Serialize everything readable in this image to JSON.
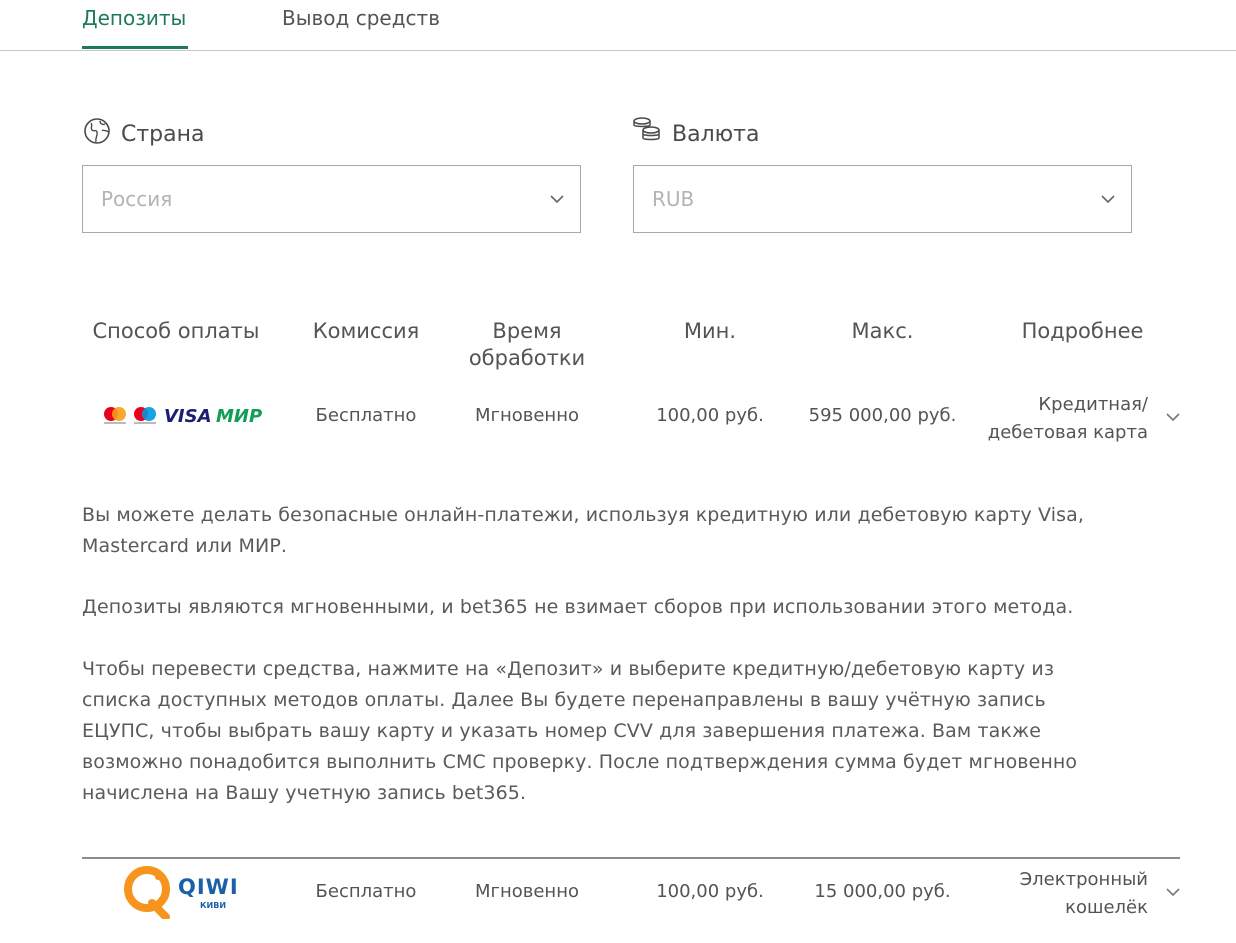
{
  "tabs": [
    {
      "label": "Депозиты",
      "active": true
    },
    {
      "label": "Вывод средств",
      "active": false
    }
  ],
  "filters": {
    "country": {
      "label": "Страна",
      "icon": "globe-icon",
      "value": "Россия"
    },
    "currency": {
      "label": "Валюта",
      "icon": "coins-icon",
      "value": "RUB"
    }
  },
  "table": {
    "headers": [
      "Способ оплаты",
      "Комиссия",
      "Время обработки",
      "Мин.",
      "Макс.",
      "Подробнее"
    ],
    "header_time_line1": "Время",
    "header_time_line2": "обработки",
    "rows": [
      {
        "method_icons": [
          "mastercard-icon",
          "maestro-icon",
          "visa-logo",
          "mir-logo"
        ],
        "visa_text": "VISA",
        "mir_text": "МИР",
        "commission": "Бесплатно",
        "time": "Мгновенно",
        "min": "100,00 руб.",
        "max": "595 000,00 руб.",
        "details_line1": "Кредитная/",
        "details_line2": "дебетовая карта",
        "expanded": true
      },
      {
        "method_icons": [
          "qiwi-logo"
        ],
        "qiwi_text": "QIWI",
        "qiwi_sub": "КИВИ",
        "commission": "Бесплатно",
        "time": "Мгновенно",
        "min": "100,00 руб.",
        "max": "15 000,00 руб.",
        "details_line1": "Электронный",
        "details_line2": "кошелёк",
        "expanded": false
      }
    ]
  },
  "description": {
    "p1_line1": "Вы можете делать безопасные онлайн-платежи, используя кредитную или дебетовую карту Visa,",
    "p1_line2": "Mastercard или МИР.",
    "p2": "Депозиты являются мгновенными, и bet365 не взимает сборов при использовании этого метода.",
    "p3_lines": [
      "Чтобы перевести средства, нажмите на «Депозит» и выберите кредитную/дебетовую карту из",
      "списка доступных методов оплаты. Далее Вы будете перенаправлены в вашу учётную запись",
      "ЕЦУПС, чтобы выбрать вашу карту и указать номер CVV для завершения платежа. Вам также",
      "возможно понадобится выполнить СМС проверку. После подтверждения сумма будет мгновенно",
      "начислена на Вашу учетную запись bet365."
    ]
  },
  "colors": {
    "accent": "#1e7a5a",
    "text": "#545454",
    "placeholder": "#b3b3b3"
  }
}
